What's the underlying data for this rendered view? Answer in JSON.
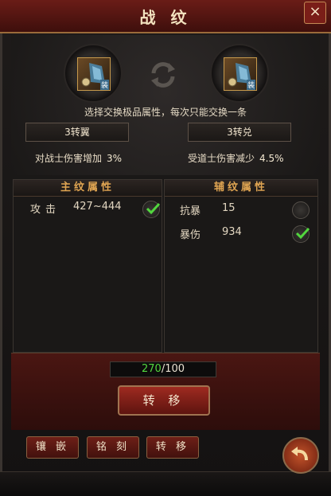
{
  "window": {
    "title": "战 纹",
    "close_label": "×"
  },
  "slots": {
    "left_tag": "装",
    "right_tag": "装",
    "hint": "选择交换极品属性，每次只能交换一条"
  },
  "left_item": {
    "tag_label": "3转翼",
    "stat_label": "对战士伤害增加",
    "stat_value": "3%"
  },
  "right_item": {
    "tag_label": "3转兑",
    "stat_label": "受道士伤害减少",
    "stat_value": "4.5%"
  },
  "main_panel": {
    "header": "主纹属性",
    "rows": [
      {
        "name": "攻击",
        "value": "427~444",
        "checked": true
      }
    ]
  },
  "aux_panel": {
    "header": "辅纹属性",
    "rows": [
      {
        "name": "抗暴",
        "value": "15",
        "checked": false
      },
      {
        "name": "暴伤",
        "value": "934",
        "checked": true
      }
    ]
  },
  "progress": {
    "current": "270",
    "total": "/100"
  },
  "transfer_button": "转 移",
  "tabs": [
    "镶 嵌",
    "铭 刻",
    "转 移"
  ],
  "colors": {
    "accent_red": "#7a1e18",
    "gold_text": "#e0a552",
    "check_green": "#52d63e"
  }
}
